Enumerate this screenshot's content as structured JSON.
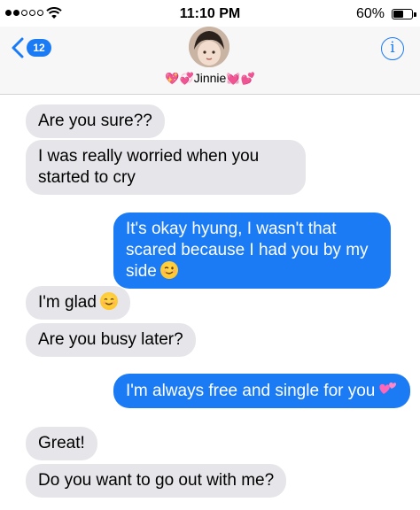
{
  "status_bar": {
    "time": "11:10 PM",
    "battery_percent": "60%",
    "signal_bars_filled": 2,
    "signal_bars_total": 5
  },
  "header": {
    "unread_count": "12",
    "contact_name": "Jinnie",
    "name_decoration_left": "💖💞",
    "name_decoration_right": "💓💕",
    "info_label": "i"
  },
  "messages": [
    {
      "direction": "received",
      "text": "Are you sure??"
    },
    {
      "direction": "received",
      "text": "I was really worried when you started to cry"
    },
    {
      "direction": "sent",
      "text": "It's okay hyung, I wasn't that scared because I had you by my side",
      "emoji": "wink-face"
    },
    {
      "direction": "received",
      "text": "I'm glad",
      "emoji": "smile-face"
    },
    {
      "direction": "received",
      "text": "Are you busy later?"
    },
    {
      "direction": "sent",
      "text": "I'm always free and single for you",
      "emoji": "two-hearts"
    },
    {
      "direction": "received",
      "text": "Great!"
    },
    {
      "direction": "received",
      "text": "Do you want to go out with me?"
    }
  ],
  "colors": {
    "sent_bubble": "#1a7bf5",
    "received_bubble": "#e6e6ea",
    "header_bg": "#f7f7f8",
    "accent": "#1a7bf5"
  }
}
